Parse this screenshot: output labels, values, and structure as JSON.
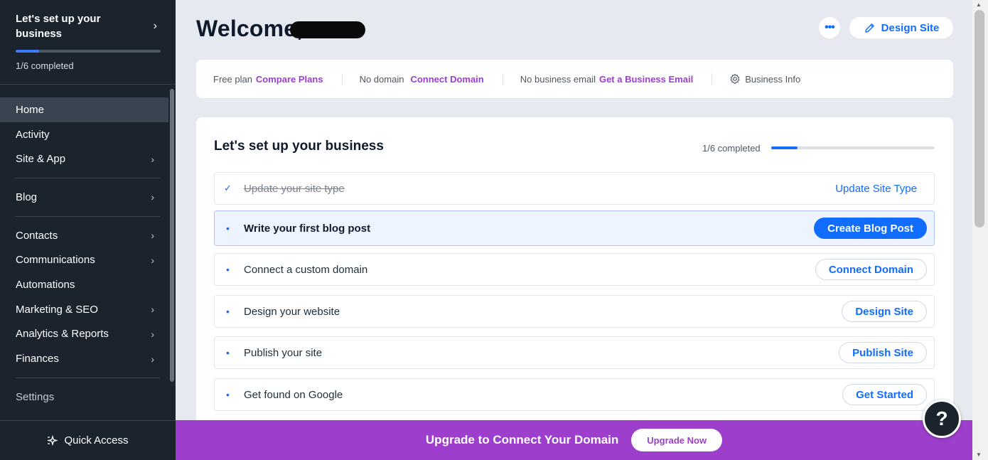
{
  "sidebar": {
    "setup": {
      "title": "Let's set up your business",
      "count": "1/6 completed",
      "progress": 0.16
    },
    "items": [
      {
        "label": "Home",
        "chevron": false,
        "active": true
      },
      {
        "label": "Activity",
        "chevron": false
      },
      {
        "label": "Site & App",
        "chevron": true
      },
      {
        "label": "Blog",
        "chevron": true
      },
      {
        "label": "Contacts",
        "chevron": true
      },
      {
        "label": "Communications",
        "chevron": true
      },
      {
        "label": "Automations",
        "chevron": false
      },
      {
        "label": "Marketing & SEO",
        "chevron": true
      },
      {
        "label": "Analytics & Reports",
        "chevron": true
      },
      {
        "label": "Finances",
        "chevron": true
      },
      {
        "label": "Settings",
        "chevron": false
      }
    ],
    "quick_access": "Quick Access"
  },
  "header": {
    "welcome": "Welcome,",
    "more_icon": "more-dots-icon",
    "design_site": "Design Site"
  },
  "plan_bar": {
    "plan": "Free plan",
    "plan_link": "Compare Plans",
    "domain": "No domain",
    "domain_link": "Connect Domain",
    "email": "No business email",
    "email_link": "Get a Business Email",
    "info": "Business Info"
  },
  "setup_panel": {
    "title": "Let's set up your business",
    "count": "1/6 completed",
    "progress": 0.16,
    "tasks": [
      {
        "label": "Update your site type",
        "action": "Update Site Type",
        "status": "done"
      },
      {
        "label": "Write your first blog post",
        "action": "Create Blog Post",
        "status": "current"
      },
      {
        "label": "Connect a custom domain",
        "action": "Connect Domain",
        "status": "todo"
      },
      {
        "label": "Design your website",
        "action": "Design Site",
        "status": "todo"
      },
      {
        "label": "Publish your site",
        "action": "Publish Site",
        "status": "todo"
      },
      {
        "label": "Get found on Google",
        "action": "Get Started",
        "status": "todo"
      }
    ]
  },
  "upgrade_bar": {
    "text": "Upgrade to Connect Your Domain",
    "button": "Upgrade Now"
  },
  "help": {
    "label": "?"
  },
  "colors": {
    "accent": "#116dff",
    "upgrade": "#9d3fcc",
    "sidebar": "#1b232d",
    "link": "#9c3ed1"
  }
}
